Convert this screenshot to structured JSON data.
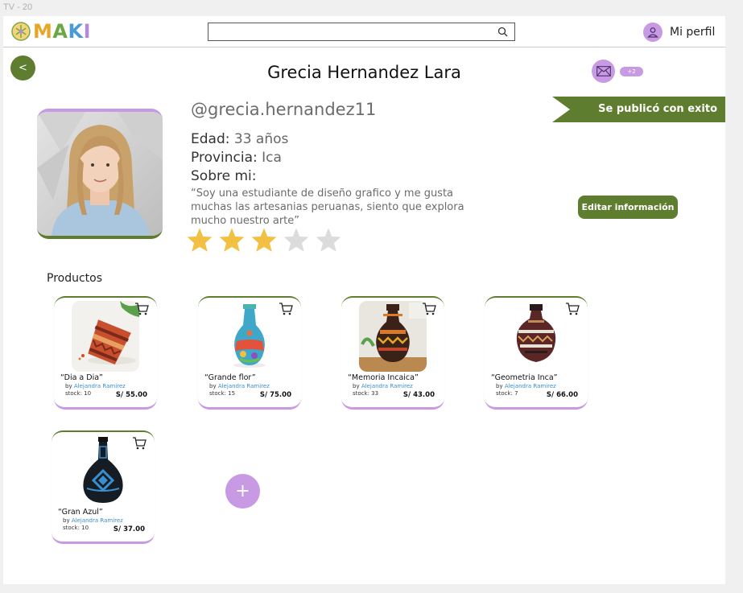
{
  "frame_label": "TV - 20",
  "header": {
    "logo_text": "MAKI",
    "logo_letters": [
      {
        "char": "M",
        "color": "#e8a628"
      },
      {
        "char": "A",
        "color": "#6aa843"
      },
      {
        "char": "K",
        "color": "#4a9ad6"
      },
      {
        "char": "I",
        "color": "#b48ad6"
      }
    ],
    "search": {
      "value": "",
      "placeholder": ""
    },
    "profile_label": "Mi perfil"
  },
  "back_label": "<",
  "profile": {
    "name": "Grecia Hernandez Lara",
    "handle": "@grecia.hernandez11",
    "age_label": "Edad:",
    "age_value": "33 años",
    "province_label": "Provincia:",
    "province_value": "Ica",
    "about_label": "Sobre mi:",
    "about_text": "“Soy una estudiante de diseño grafico y me gusta muchas las artesanias peruanas, siento que explora mucho nuestro arte”",
    "rating": 3,
    "rating_max": 5
  },
  "notification_badge": "+2",
  "toast": "Se publicó con exito",
  "edit_button": "Editar información",
  "section_title": "Productos",
  "products": [
    {
      "title": "“Dia a Dia”",
      "by": "by",
      "author": "Alejandra Ramirez",
      "stock_label": "stock:",
      "stock": "10",
      "price": "S/ 55.00"
    },
    {
      "title": "“Grande flor”",
      "by": "by",
      "author": "Alejandra Ramirez",
      "stock_label": "stock:",
      "stock": "15",
      "price": "S/ 75.00"
    },
    {
      "title": "“Memoria Incaica”",
      "by": "by",
      "author": "Alejandra Ramirez",
      "stock_label": "stock:",
      "stock": "33",
      "price": "S/ 43.00"
    },
    {
      "title": "“Geometria Inca”",
      "by": "by",
      "author": "Alejandra Ramirez",
      "stock_label": "stock:",
      "stock": "7",
      "price": "S/ 66.00"
    },
    {
      "title": "“Gran Azul”",
      "by": "by",
      "author": "Alejandra Ramirez",
      "stock_label": "stock:",
      "stock": "10",
      "price": "S/ 37.00"
    }
  ],
  "add_button": "+",
  "colors": {
    "brand_green": "#5e7d2f",
    "brand_purple": "#c79ae3",
    "star_filled": "#f2c043",
    "star_empty": "#dcdcdc",
    "link_blue": "#3a8fd0"
  },
  "icons": {
    "search": "search-icon",
    "profile": "user-icon",
    "mail": "mail-icon",
    "cart": "cart-icon",
    "star": "star-icon"
  }
}
